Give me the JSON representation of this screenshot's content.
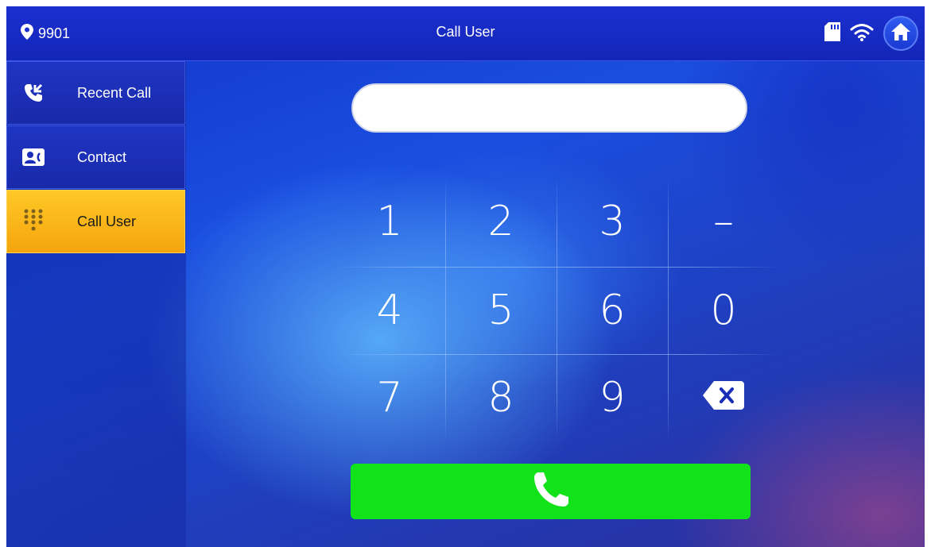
{
  "header": {
    "room_number": "9901",
    "title": "Call User",
    "icons": [
      "location-pin-icon",
      "sd-card-icon",
      "wifi-icon",
      "home-icon"
    ]
  },
  "sidebar": {
    "items": [
      {
        "label": "Recent Call",
        "icon": "recent-call-icon",
        "active": false
      },
      {
        "label": "Contact",
        "icon": "contact-card-icon",
        "active": false
      },
      {
        "label": "Call User",
        "icon": "dialpad-icon",
        "active": true
      }
    ]
  },
  "dial_input": {
    "value": "",
    "placeholder": ""
  },
  "keypad": {
    "keys": [
      "1",
      "2",
      "3",
      "–",
      "4",
      "5",
      "6",
      "0",
      "7",
      "8",
      "9"
    ],
    "backspace_icon": "backspace-icon"
  },
  "call_button": {
    "icon": "phone-icon"
  },
  "colors": {
    "active_tab": "#f8b41a",
    "call_button": "#12e21a",
    "top_bar": "#1a2ec8"
  }
}
